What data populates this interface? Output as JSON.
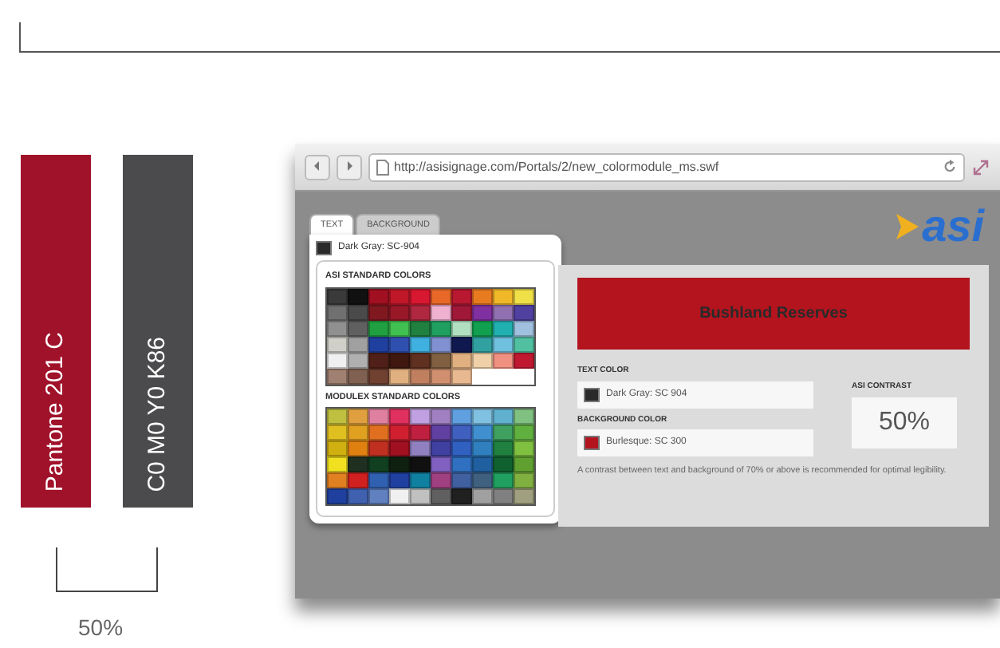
{
  "swatch_bars": [
    {
      "label": "Pantone 201 C",
      "color": "#a0112a"
    },
    {
      "label": "C0 M0 Y0 K86",
      "color": "#4b4b4d"
    }
  ],
  "bracket_label": "50%",
  "browser": {
    "address": "http://asisignage.com/Portals/2/new_colormodule_ms.swf",
    "logo": "asi",
    "picker": {
      "tabs": [
        {
          "label": "TEXT",
          "selected": true
        },
        {
          "label": "BACKGROUND",
          "selected": false
        }
      ],
      "current": {
        "label": "Dark Gray: SC-904",
        "color": "#2a2a2a"
      },
      "palettes": [
        {
          "title": "ASI STANDARD COLORS",
          "rows": [
            [
              {
                "color": "#3a3a3a"
              },
              {
                "color": "#111111"
              },
              {
                "color": "#a01020"
              },
              {
                "color": "#c01828"
              },
              {
                "color": "#d81830"
              },
              {
                "color": "#e86828"
              },
              {
                "color": "#b81830"
              },
              {
                "color": "#e87a20"
              },
              {
                "color": "#f0b828"
              },
              {
                "color": "#f0e048"
              }
            ],
            [
              {
                "color": "#707070"
              },
              {
                "color": "#4a4a4a"
              },
              {
                "color": "#801820"
              },
              {
                "color": "#981828"
              },
              {
                "color": "#b02840"
              },
              {
                "color": "#f0b0d0"
              },
              {
                "color": "#a01838"
              },
              {
                "color": "#8030a0"
              },
              {
                "color": "#9070b0"
              },
              {
                "color": "#5040a0"
              }
            ],
            [
              {
                "color": "#909090"
              },
              {
                "color": "#606060"
              },
              {
                "color": "#20a040"
              },
              {
                "color": "#40c050"
              },
              {
                "color": "#208040"
              },
              {
                "color": "#20a060"
              },
              {
                "color": "#b0e0c0"
              },
              {
                "color": "#10a050"
              },
              {
                "color": "#20b0b0"
              },
              {
                "color": "#a0c0e0"
              }
            ],
            [
              {
                "color": "#d0d0c8"
              },
              {
                "color": "#a0a0a0"
              },
              {
                "color": "#2040a0"
              },
              {
                "color": "#3050b0"
              },
              {
                "color": "#40b0e0"
              },
              {
                "color": "#8090d0"
              },
              {
                "color": "#101850"
              },
              {
                "color": "#30a0a0"
              },
              {
                "color": "#70c0e0"
              },
              {
                "color": "#50c0a0"
              }
            ],
            [
              {
                "color": "#f0f0f0"
              },
              {
                "color": "#b0b0b0"
              },
              {
                "color": "#502018"
              },
              {
                "color": "#401810"
              },
              {
                "color": "#603020"
              },
              {
                "color": "#806040"
              },
              {
                "color": "#e0b080"
              },
              {
                "color": "#f0d0a8"
              },
              {
                "color": "#f09080"
              },
              {
                "color": "#c01830"
              }
            ],
            [
              {
                "color": "#a08070"
              },
              {
                "color": "#806050"
              },
              {
                "color": "#704030"
              },
              {
                "color": "#e0b080"
              },
              {
                "color": "#c08060"
              },
              {
                "color": "#d09070"
              },
              {
                "color": "#e8b890"
              }
            ]
          ]
        },
        {
          "title": "MODULEX STANDARD COLORS",
          "rows": [
            [
              {
                "color": "#c0c040"
              },
              {
                "color": "#e0a040"
              },
              {
                "color": "#e080a0"
              },
              {
                "color": "#e03060"
              },
              {
                "color": "#c0a0e0"
              },
              {
                "color": "#a080c0"
              },
              {
                "color": "#60a0e0"
              },
              {
                "color": "#80c0e0"
              },
              {
                "color": "#60b0d0"
              },
              {
                "color": "#80c080"
              }
            ],
            [
              {
                "color": "#e0c020"
              },
              {
                "color": "#e0a020"
              },
              {
                "color": "#e07020"
              },
              {
                "color": "#d02030"
              },
              {
                "color": "#c02040"
              },
              {
                "color": "#6040a0"
              },
              {
                "color": "#4060c0"
              },
              {
                "color": "#4090d0"
              },
              {
                "color": "#40a060"
              },
              {
                "color": "#60b040"
              }
            ],
            [
              {
                "color": "#d0b010"
              },
              {
                "color": "#e08010"
              },
              {
                "color": "#c03020"
              },
              {
                "color": "#a01020"
              },
              {
                "color": "#9080c0"
              },
              {
                "color": "#4040a0"
              },
              {
                "color": "#3060c0"
              },
              {
                "color": "#3080c0"
              },
              {
                "color": "#208040"
              },
              {
                "color": "#80c040"
              }
            ],
            [
              {
                "color": "#f0e020"
              },
              {
                "color": "#203020"
              },
              {
                "color": "#104020"
              },
              {
                "color": "#102010"
              },
              {
                "color": "#101010"
              },
              {
                "color": "#8060c0"
              },
              {
                "color": "#3070c0"
              },
              {
                "color": "#2060a0"
              },
              {
                "color": "#106030"
              },
              {
                "color": "#60a030"
              }
            ],
            [
              {
                "color": "#e08020"
              },
              {
                "color": "#d02020"
              },
              {
                "color": "#3060b0"
              },
              {
                "color": "#2040a0"
              },
              {
                "color": "#1080a0"
              },
              {
                "color": "#a04080"
              },
              {
                "color": "#4060a0"
              },
              {
                "color": "#406080"
              },
              {
                "color": "#20a060"
              },
              {
                "color": "#80b040"
              }
            ],
            [
              {
                "color": "#2040a0"
              },
              {
                "color": "#4060b0"
              },
              {
                "color": "#6080c0"
              },
              {
                "color": "#f0f0f0"
              },
              {
                "color": "#c0c0c0"
              },
              {
                "color": "#606060"
              },
              {
                "color": "#202020"
              },
              {
                "color": "#a0a0a0"
              },
              {
                "color": "#808080"
              },
              {
                "color": "#a0a080"
              }
            ]
          ]
        }
      ]
    },
    "preview": {
      "text": "Bushland Reserves"
    },
    "fields": [
      {
        "label": "TEXT COLOR",
        "value": "Dark Gray: SC 904",
        "color": "#2a2a2a"
      },
      {
        "label": "BACKGROUND COLOR",
        "value": "Burlesque: SC 300",
        "color": "#b3141e"
      }
    ],
    "contrast": {
      "label": "ASI CONTRAST",
      "value": "50%"
    },
    "note": "A contrast between text and background of 70% or above is recommended for optimal legibility."
  }
}
